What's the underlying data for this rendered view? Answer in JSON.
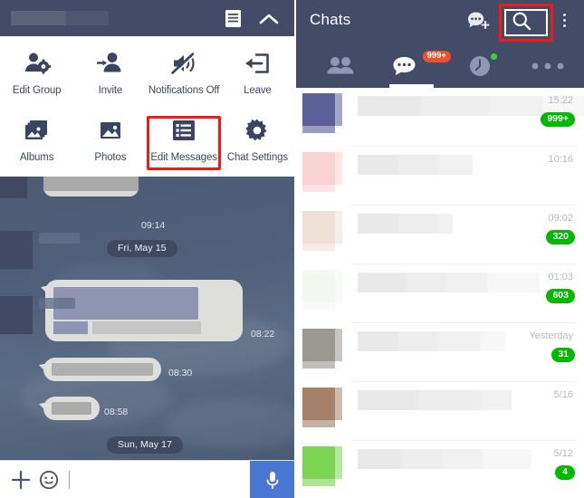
{
  "left_panel": {
    "topbar": {
      "title_redacted": "",
      "list_icon": "list-icon",
      "collapse_icon": "chevron-up-icon"
    },
    "menu": {
      "items": [
        {
          "label": "Edit Group",
          "icon": "person-gear-icon",
          "highlighted": false
        },
        {
          "label": "Invite",
          "icon": "person-add-icon",
          "highlighted": false
        },
        {
          "label": "Notifications Off",
          "icon": "speaker-mute-icon",
          "highlighted": false
        },
        {
          "label": "Leave",
          "icon": "exit-arrow-icon",
          "highlighted": false
        },
        {
          "label": "Albums",
          "icon": "albums-icon",
          "highlighted": false
        },
        {
          "label": "Photos",
          "icon": "photo-icon",
          "highlighted": false
        },
        {
          "label": "Edit Messages",
          "icon": "list-lines-icon",
          "highlighted": true
        },
        {
          "label": "Chat Settings",
          "icon": "gear-icon",
          "highlighted": false
        }
      ]
    },
    "conversation": {
      "messages": [
        {
          "time": "09:14",
          "side": "incoming",
          "redacted": true
        },
        {
          "time": "08:22",
          "side": "incoming",
          "redacted": true
        },
        {
          "time": "08:30",
          "side": "incoming",
          "redacted": true
        },
        {
          "time": "08:58",
          "side": "incoming",
          "redacted": true
        }
      ],
      "date_separators": [
        "Fri, May 15",
        "Sun, May 17"
      ]
    },
    "input_bar": {
      "add_icon": "plus-icon",
      "emoji_icon": "smiley-icon",
      "text_value": "",
      "placeholder": "",
      "mic_icon": "microphone-icon"
    }
  },
  "right_panel": {
    "header": {
      "title": "Chats",
      "new_chat_icon": "new-chat-icon",
      "search_icon": "search-icon",
      "more_icon": "more-vertical-icon"
    },
    "tabs": [
      {
        "name": "friends",
        "icon": "friends-icon",
        "badge": "",
        "active": false,
        "dot": false
      },
      {
        "name": "chats",
        "icon": "chat-bubble-icon",
        "badge": "999+",
        "active": true,
        "dot": false
      },
      {
        "name": "timeline",
        "icon": "clock-icon",
        "badge": "",
        "active": false,
        "dot": true
      },
      {
        "name": "more",
        "icon": "more-dots-icon",
        "badge": "",
        "active": false,
        "dot": false
      }
    ],
    "chat_list": [
      {
        "avatar_color": "#5a6199",
        "time": "15:22",
        "badge": "999+",
        "line_w": [
          70,
          74,
          60,
          50
        ]
      },
      {
        "avatar_color": "#f9d3d0",
        "time": "10:16",
        "badge": "",
        "line_w": [
          45,
          45,
          37,
          0
        ]
      },
      {
        "avatar_color": "#efe0d6",
        "time": "09:02",
        "badge": "320",
        "line_w": [
          45,
          43,
          17,
          0
        ]
      },
      {
        "avatar_color": "#f2f7f2",
        "time": "01:03",
        "badge": "603",
        "line_w": [
          53,
          45,
          45,
          58
        ]
      },
      {
        "avatar_color": "#9a9890",
        "time": "Yesterday",
        "badge": "31",
        "line_w": [
          45,
          45,
          45,
          28
        ]
      },
      {
        "avatar_color": "#a5816a",
        "time": "5/16",
        "badge": "",
        "line_w": [
          68,
          68,
          34,
          0
        ]
      },
      {
        "avatar_color": "#7ed455",
        "time": "5/12",
        "badge": "4",
        "line_w": [
          48,
          45,
          45,
          54
        ]
      }
    ]
  },
  "highlights": {
    "edit_messages_box_color": "#ee1b16",
    "search_box_color": "#ee1b16"
  }
}
